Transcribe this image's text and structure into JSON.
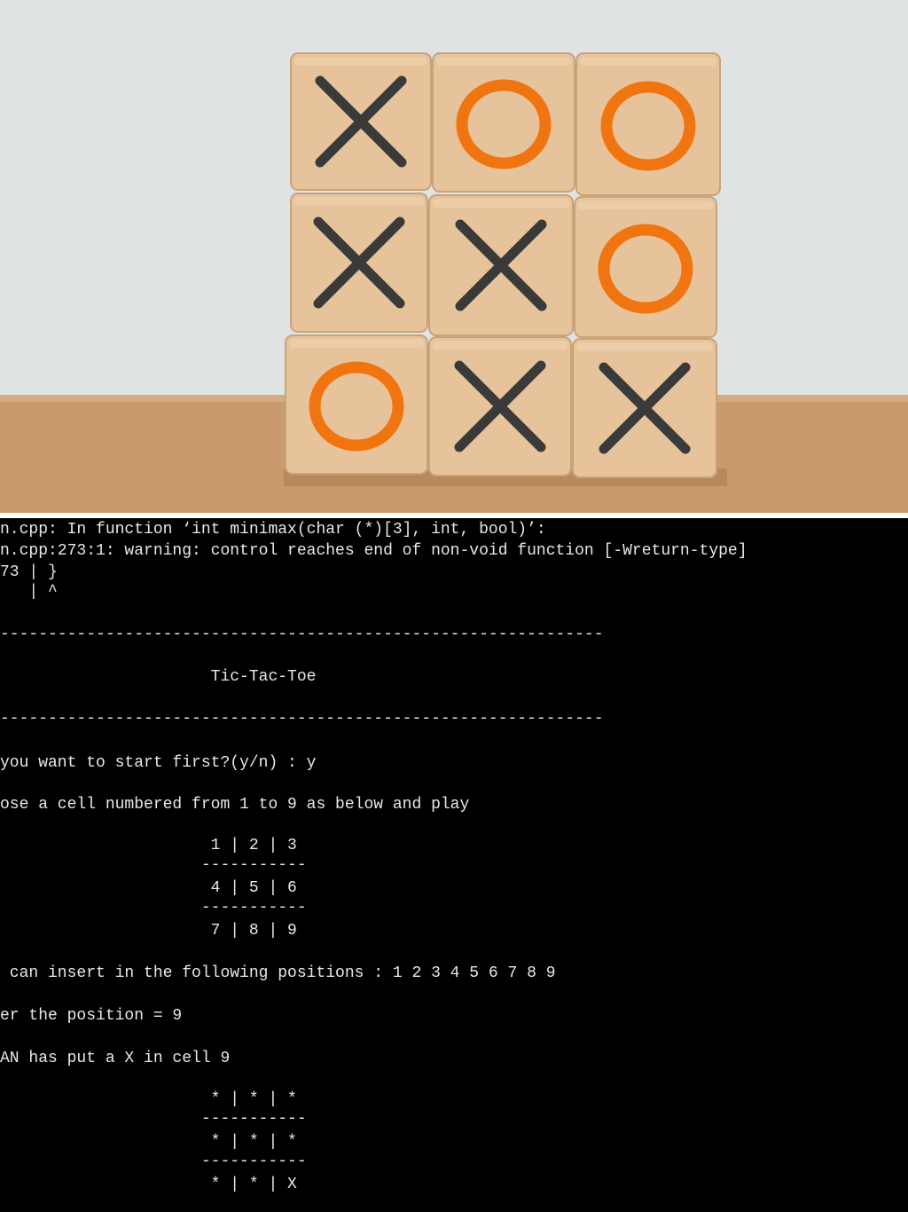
{
  "photo": {
    "alt_icon": "tic-tac-toe-wooden-blocks",
    "colors": {
      "background": "#dfe3e4",
      "table": "#c89a6a",
      "block": "#e6c39b",
      "x_mark": "#3a3a3a",
      "o_mark": "#f07510"
    },
    "board": [
      [
        "X",
        "O",
        "O"
      ],
      [
        "X",
        "X",
        "O"
      ],
      [
        "O",
        "X",
        "X"
      ]
    ]
  },
  "terminal": {
    "lines": [
      "n.cpp: In function ‘int minimax(char (*)[3], int, bool)’:",
      "n.cpp:273:1: warning: control reaches end of non-void function [-Wreturn-type]",
      "73 | }",
      "   | ^",
      "---------------------------------------------------------------",
      "                      Tic-Tac-Toe",
      "---------------------------------------------------------------",
      "you want to start first?(y/n) : y",
      "ose a cell numbered from 1 to 9 as below and play",
      "                      1 | 2 | 3",
      "                     -----------",
      "                      4 | 5 | 6",
      "                     -----------",
      "                      7 | 8 | 9",
      " can insert in the following positions : 1 2 3 4 5 6 7 8 9",
      "er the position = 9",
      "AN has put a X in cell 9",
      "                      * | * | *",
      "                     -----------",
      "                      * | * | *",
      "                     -----------",
      "                      * | * | X"
    ]
  }
}
